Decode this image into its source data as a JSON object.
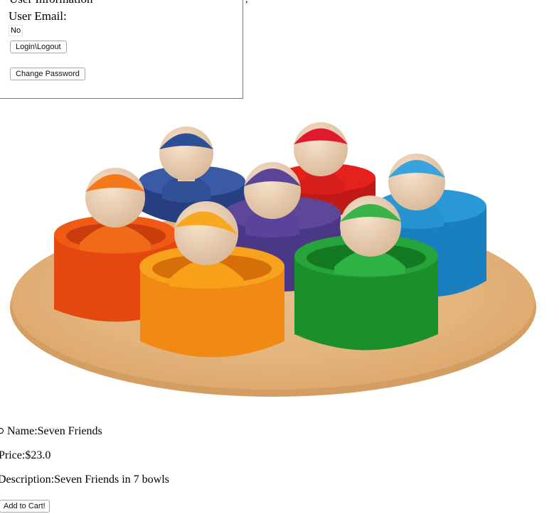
{
  "user_panel": {
    "title": "User Information",
    "email_label": "User Email:",
    "login_status": "No",
    "login_button": "Login\\Logout",
    "change_password_button": "Change Password"
  },
  "product": {
    "name": "Name:Seven Friends",
    "price": "Price:$23.0",
    "description": "Description:Seven Friends in 7 bowls",
    "add_to_cart_button": "Add to Cart!"
  },
  "colors": {
    "plate": "#e9c08e",
    "red": "#e4211c",
    "orange": "#f07d14",
    "yellow": "#f6a21a",
    "green": "#22a02e",
    "blue": "#1f8fcf",
    "indigo": "#2f4a8f",
    "violet": "#5e4699"
  }
}
